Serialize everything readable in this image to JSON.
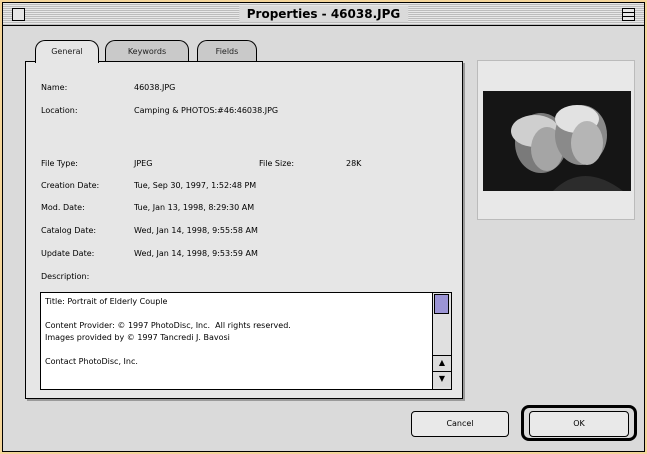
{
  "window": {
    "title": "Properties - 46038.JPG"
  },
  "tabs": [
    {
      "label": "General",
      "active": true
    },
    {
      "label": "Keywords",
      "active": false
    },
    {
      "label": "Fields",
      "active": false
    }
  ],
  "fields": {
    "name": {
      "label": "Name:",
      "value": "46038.JPG"
    },
    "location": {
      "label": "Location:",
      "value": "Camping & PHOTOS:#46:46038.JPG"
    },
    "file_type": {
      "label": "File Type:",
      "value": "JPEG"
    },
    "file_size": {
      "label": "File Size:",
      "value": "28K"
    },
    "creation_date": {
      "label": "Creation Date:",
      "value": "Tue, Sep 30, 1997, 1:52:48 PM"
    },
    "mod_date": {
      "label": "Mod. Date:",
      "value": "Tue, Jan 13, 1998, 8:29:30 AM"
    },
    "catalog_date": {
      "label": "Catalog Date:",
      "value": "Wed, Jan 14, 1998, 9:55:58 AM"
    },
    "update_date": {
      "label": "Update Date:",
      "value": "Wed, Jan 14, 1998, 9:53:59 AM"
    },
    "description_label": "Description:"
  },
  "description": {
    "text": "Title: Portrait of Elderly Couple\n\nContent Provider: © 1997 PhotoDisc, Inc.  All rights reserved.\nImages provided by © 1997 Tancredi J. Bavosi\n\nContact PhotoDisc, Inc."
  },
  "scrollbar": {
    "up_arrow": "▲",
    "down_arrow": "▼"
  },
  "buttons": {
    "cancel": "Cancel",
    "ok": "OK"
  }
}
